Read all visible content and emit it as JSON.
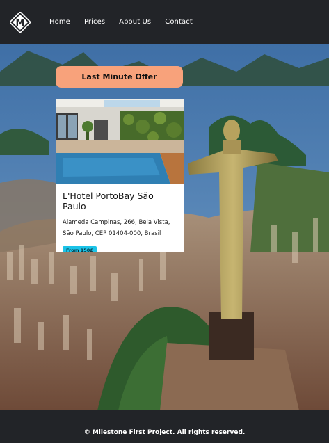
{
  "nav": {
    "logo_letter": "M",
    "links": [
      "Home",
      "Prices",
      "About Us",
      "Contact"
    ]
  },
  "offer": {
    "banner": "Last Minute Offer",
    "hotel_name": "L'Hotel PortoBay São Paulo",
    "address_line1": "Alameda Campinas, 266, Bela Vista,",
    "address_line2": "São Paulo, CEP 01404-000, Brasil",
    "price": "From 150£"
  },
  "footer": {
    "copyright": "© Milestone First Project. All rights reserved."
  },
  "colors": {
    "header_bg": "#222428",
    "banner_bg": "#f8a27b",
    "badge_bg": "#1bc3e8"
  }
}
